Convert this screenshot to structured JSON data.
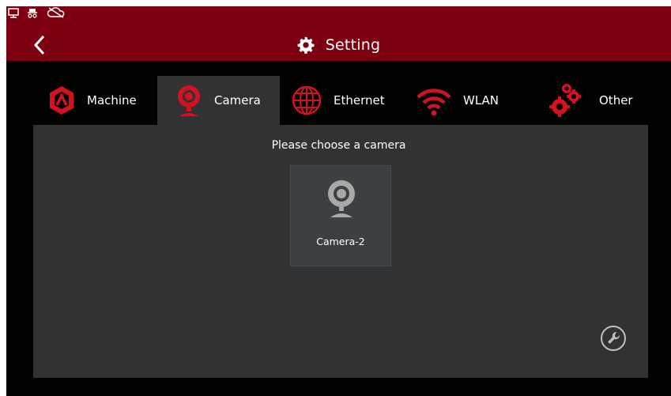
{
  "header": {
    "title": "Setting"
  },
  "tabs": [
    {
      "label": "Machine",
      "icon": "machine-logo-icon",
      "active": false
    },
    {
      "label": "Camera",
      "icon": "webcam-icon",
      "active": true
    },
    {
      "label": "Ethernet",
      "icon": "globe-icon",
      "active": false
    },
    {
      "label": "WLAN",
      "icon": "wifi-icon",
      "active": false
    },
    {
      "label": "Other",
      "icon": "gears-icon",
      "active": false
    }
  ],
  "camera_panel": {
    "prompt": "Please choose a camera",
    "cameras": [
      {
        "label": "Camera-2"
      }
    ]
  },
  "colors": {
    "header_bg": "#7c0010",
    "accent_red": "#d4111f",
    "panel_bg": "#303234",
    "screen_bg": "#000000"
  }
}
